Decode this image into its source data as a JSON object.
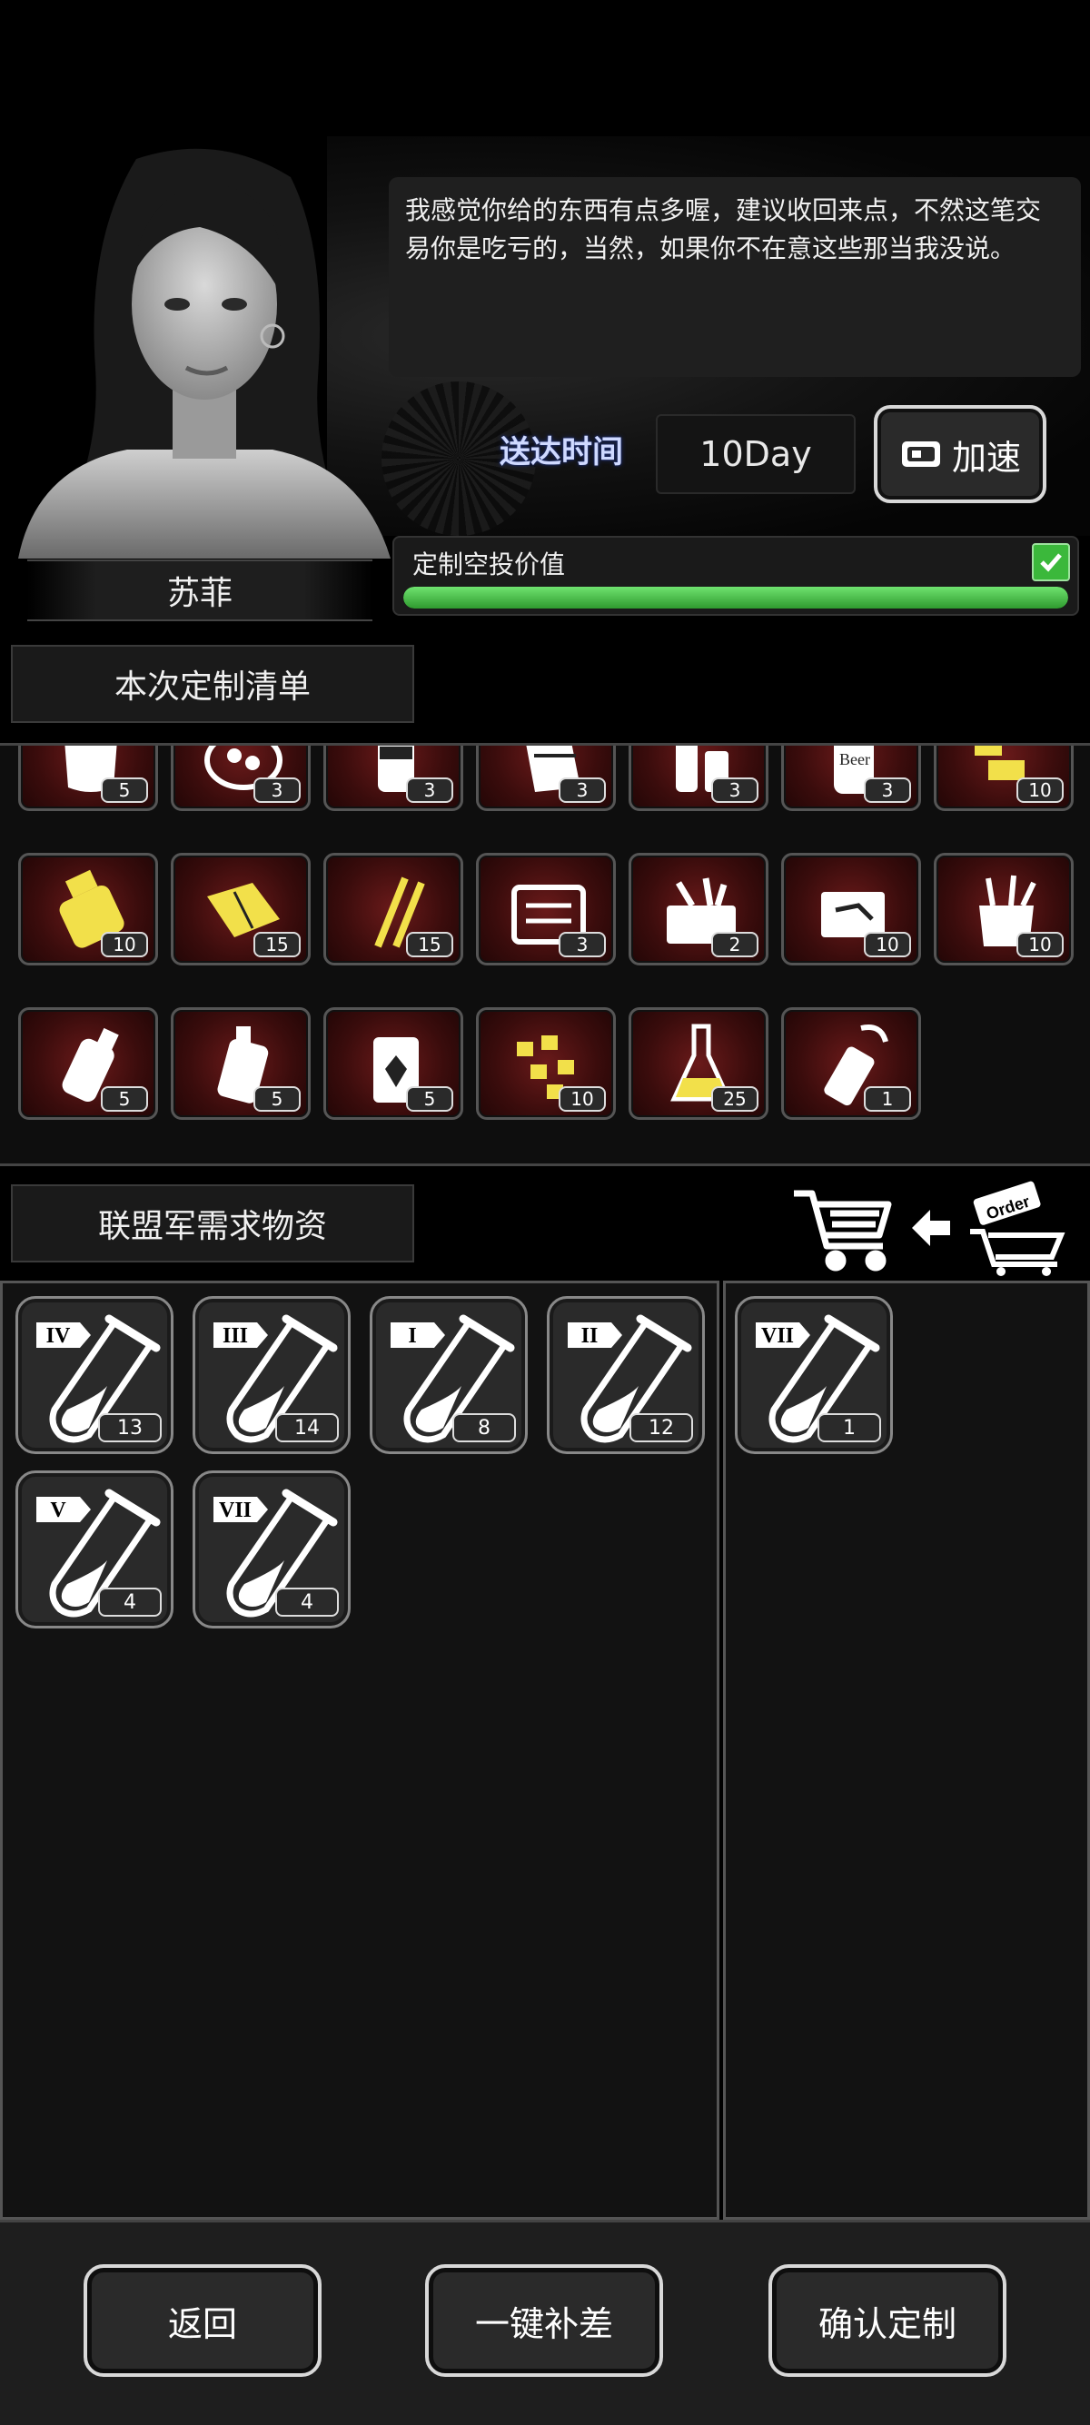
{
  "npc": {
    "name": "苏菲",
    "dialog": "我感觉你给的东西有点多喔，建议收回来点，不然这笔交易你是吃亏的，当然，如果你不在意这些那当我没说。"
  },
  "delivery": {
    "label": "送达时间",
    "value": "10Day",
    "speed_button": "加速"
  },
  "airdrop_value": {
    "label": "定制空投价值",
    "fill_fraction": 1.0,
    "checked": true
  },
  "custom_list": {
    "title": "本次定制清单",
    "items": [
      {
        "icon": "cloth-item-icon",
        "count": "5"
      },
      {
        "icon": "food-bowl-icon",
        "count": "3"
      },
      {
        "icon": "coffee-can-icon",
        "count": "3"
      },
      {
        "icon": "chocolate-bar-icon",
        "count": "3"
      },
      {
        "icon": "bottles-icon",
        "count": "3"
      },
      {
        "icon": "beer-can-icon",
        "count": "3"
      },
      {
        "icon": "gold-parts-icon",
        "count": "10"
      },
      {
        "icon": "gold-cylinder-icon",
        "count": "10"
      },
      {
        "icon": "gold-plates-icon",
        "count": "15"
      },
      {
        "icon": "gold-wires-icon",
        "count": "15"
      },
      {
        "icon": "toolbox-icon",
        "count": "3"
      },
      {
        "icon": "tool-chest-icon",
        "count": "2"
      },
      {
        "icon": "tool-kit-icon",
        "count": "10"
      },
      {
        "icon": "tool-bag-icon",
        "count": "10"
      },
      {
        "icon": "grenade-icon",
        "count": "5"
      },
      {
        "icon": "spray-can-icon",
        "count": "5"
      },
      {
        "icon": "fuel-canister-icon",
        "count": "5"
      },
      {
        "icon": "gold-nuggets-icon",
        "count": "10"
      },
      {
        "icon": "flask-icon",
        "count": "25"
      },
      {
        "icon": "spray-bottle-icon",
        "count": "1"
      }
    ]
  },
  "alliance": {
    "title": "联盟军需求物资",
    "needs": [
      {
        "tier": "IV",
        "count": "13"
      },
      {
        "tier": "III",
        "count": "14"
      },
      {
        "tier": "I",
        "count": "8"
      },
      {
        "tier": "II",
        "count": "12"
      },
      {
        "tier": "V",
        "count": "4"
      },
      {
        "tier": "VII",
        "count": "4"
      }
    ],
    "selected": [
      {
        "tier": "VII",
        "count": "1"
      }
    ],
    "order_tag": "Order"
  },
  "buttons": {
    "back": "返回",
    "fill_gap": "一键补差",
    "confirm": "确认定制"
  },
  "colors": {
    "progress": "#3bb83b",
    "tile_red": "#5a1414",
    "gold": "#f2e04a"
  }
}
